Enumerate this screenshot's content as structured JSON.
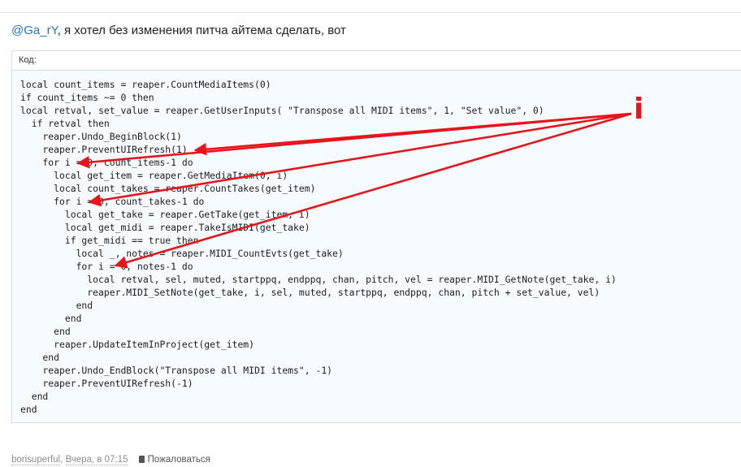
{
  "post": {
    "mention": "@Ga_rY",
    "text": ", я хотел без изменения питча айтема сделать, вот"
  },
  "code": {
    "label": "Код:",
    "lines": [
      "local count_items = reaper.CountMediaItems(0)",
      "if count_items ~= 0 then",
      "local retval, set_value = reaper.GetUserInputs( \"Transpose all MIDI items\", 1, \"Set value\", 0)",
      "  if retval then",
      "    reaper.Undo_BeginBlock(1)",
      "    reaper.PreventUIRefresh(1)",
      "    for i = 0, count_items-1 do",
      "      local get_item = reaper.GetMediaItem(0, i)",
      "      local count_takes = reaper.CountTakes(get_item)",
      "      for i = 0, count_takes-1 do",
      "        local get_take = reaper.GetTake(get_item, i)",
      "        local get_midi = reaper.TakeIsMIDI(get_take)",
      "        if get_midi == true then",
      "          local _, notes = reaper.MIDI_CountEvts(get_take)",
      "          for i = 0, notes-1 do",
      "            local retval, sel, muted, startppq, endppq, chan, pitch, vel = reaper.MIDI_GetNote(get_take, i)",
      "            reaper.MIDI_SetNote(get_take, i, sel, muted, startppq, endppq, chan, pitch + set_value, vel)",
      "          end",
      "        end",
      "      end",
      "      reaper.UpdateItemInProject(get_item)",
      "    end",
      "    reaper.Undo_EndBlock(\"Transpose all MIDI items\", -1)",
      "    reaper.PreventUIRefresh(-1)",
      "  end",
      "end"
    ]
  },
  "annotation": {
    "glyph": "i",
    "color": "#e8141c"
  },
  "footer": {
    "author": "borisuperful",
    "separator": ",",
    "date": "Вчера, в 07:15",
    "report_label": "Пожаловаться"
  }
}
